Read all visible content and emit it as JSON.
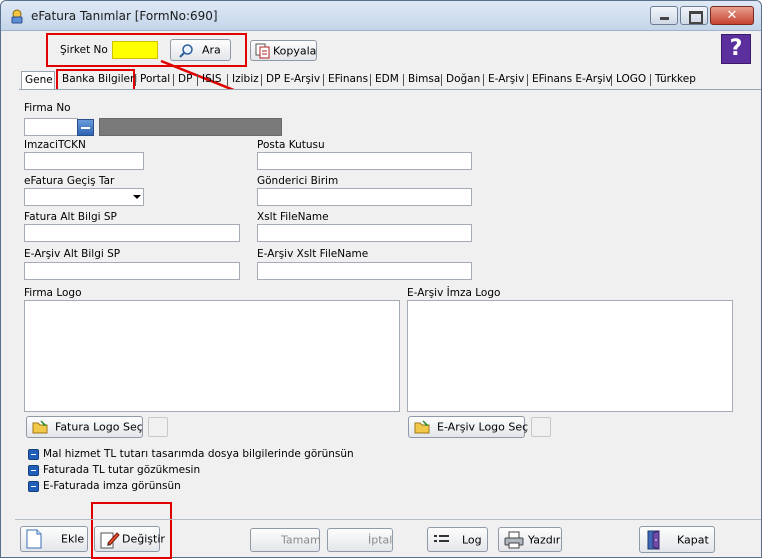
{
  "window": {
    "title": "eFatura Tanımlar [FormNo:690]"
  },
  "toolbar": {
    "sirket_label": "Şirket No",
    "sirket_value": "",
    "ara_label": "Ara",
    "kopyala_label": "Kopyala",
    "help_label": "?"
  },
  "tabs": [
    {
      "label": "Gene"
    },
    {
      "label": "Banka Bilgileri"
    },
    {
      "label": "Portal"
    },
    {
      "label": "DP"
    },
    {
      "label": "ISIS"
    },
    {
      "label": "Izibiz"
    },
    {
      "label": "DP E-Arşiv"
    },
    {
      "label": "EFinans"
    },
    {
      "label": "EDM"
    },
    {
      "label": "Bimsa"
    },
    {
      "label": "Doğan"
    },
    {
      "label": "E-Arşiv"
    },
    {
      "label": "EFinans E-Arşiv"
    },
    {
      "label": "LOGO"
    },
    {
      "label": "Türkkep"
    }
  ],
  "form": {
    "firma_no_label": "Firma No",
    "imzaci_label": "ImzaciTCKN",
    "posta_label": "Posta Kutusu",
    "gecis_label": "eFatura Geçiş Tar",
    "gonderici_label": "Gönderici Birim",
    "alt_bilgi_label": "Fatura Alt Bilgi SP",
    "xslt_label": "Xslt FileName",
    "earsiv_alt_label": "E-Arşiv Alt Bilgi SP",
    "earsiv_xslt_label": "E-Arşiv Xslt FileName",
    "firma_logo_label": "Firma Logo",
    "imza_logo_label": "E-Arşiv İmza Logo",
    "fatura_logo_btn": "Fatura Logo Seç",
    "earsiv_logo_btn": "E-Arşiv Logo Seç",
    "checks": [
      {
        "label": "Mal hizmet TL tutarı tasarımda dosya bilgilerinde görünsün"
      },
      {
        "label": "Faturada TL tutar gözükmesin"
      },
      {
        "label": "E-Faturada imza görünsün"
      }
    ]
  },
  "bottom": {
    "ekle": "Ekle",
    "degistir": "Değiştir",
    "tamam": "Tamam",
    "iptal": "İptal",
    "log": "Log",
    "yazdir": "Yazdır",
    "kapat": "Kapat"
  },
  "colors": {
    "highlight": "#e00000",
    "sirket_bg": "#ffff00",
    "help_bg": "#5c2f9e"
  }
}
